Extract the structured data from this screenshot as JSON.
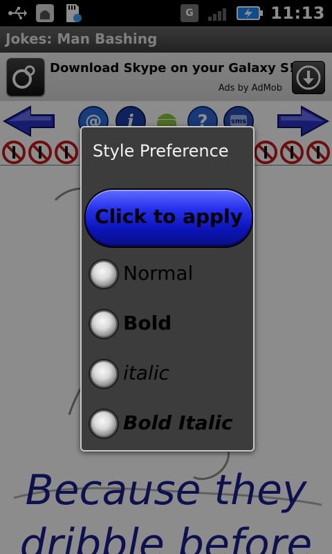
{
  "status_bar": {
    "time": "11:13",
    "icons": [
      "usb-icon",
      "android-debug-icon",
      "sd-card-icon",
      "data-sync-icon",
      "signal-icon",
      "battery-charging-icon"
    ]
  },
  "title_bar": {
    "title": "Jokes: Man Bashing"
  },
  "ad": {
    "headline": "Download Skype on your Galaxy S!",
    "attribution": "Ads by AdMob",
    "icon_left": "skype-icon",
    "icon_right": "download-icon"
  },
  "nav": {
    "left_icon": "arrow-left-icon",
    "right_icon": "arrow-right-icon",
    "center_icons": [
      "email-icon",
      "info-icon",
      "android-icon",
      "help-icon",
      "sms-icon"
    ]
  },
  "joke": {
    "visible_text": "Because they\ndribble before"
  },
  "dialog": {
    "title": "Style Preference",
    "apply_button_label": "Click to apply",
    "options": [
      {
        "label": "Normal"
      },
      {
        "label": "Bold"
      },
      {
        "label": "italic"
      },
      {
        "label": "Bold Italic"
      }
    ]
  },
  "colors": {
    "accent_blue": "#2430ea",
    "joke_text": "#1d1f8f",
    "dialog_bg": "#3c3c3c"
  }
}
